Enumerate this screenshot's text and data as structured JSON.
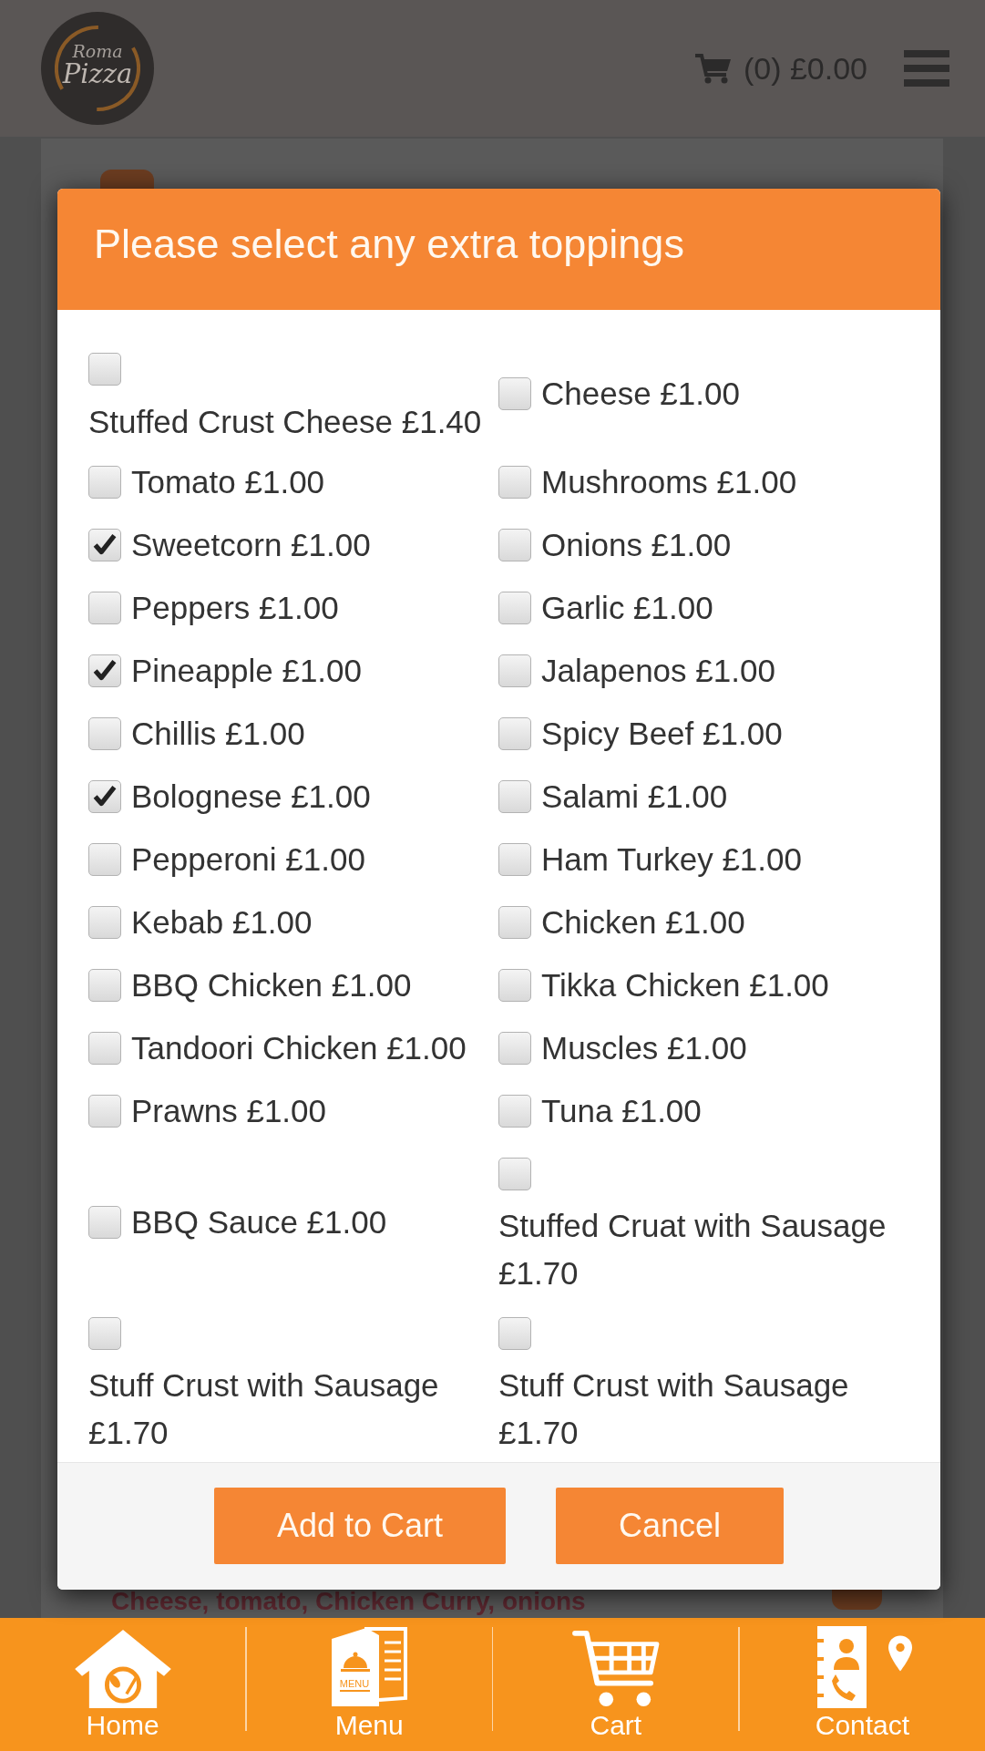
{
  "header": {
    "logo": {
      "line_1": "Roma",
      "line_2": "Pizza"
    },
    "cart_summary": "(0) £0.00"
  },
  "page": {
    "description": "Cheese, tomato, Chicken Curry, onions"
  },
  "modal": {
    "title": "Please select any extra toppings",
    "toppings": [
      {
        "label": "Stuffed Crust Cheese £1.40",
        "checked": false
      },
      {
        "label": "Tomato £1.00",
        "checked": false
      },
      {
        "label": "Sweetcorn £1.00",
        "checked": true
      },
      {
        "label": "Peppers £1.00",
        "checked": false
      },
      {
        "label": "Pineapple £1.00",
        "checked": true
      },
      {
        "label": "Chillis £1.00",
        "checked": false
      },
      {
        "label": "Bolognese £1.00",
        "checked": true
      },
      {
        "label": "Pepperoni £1.00",
        "checked": false
      },
      {
        "label": "Kebab £1.00",
        "checked": false
      },
      {
        "label": "BBQ Chicken £1.00",
        "checked": false
      },
      {
        "label": "Tandoori Chicken £1.00",
        "checked": false
      },
      {
        "label": "Prawns £1.00",
        "checked": false
      },
      {
        "label": "BBQ Sauce £1.00",
        "checked": false
      },
      {
        "label": "Stuff Crust with Sausage £1.70",
        "checked": false
      },
      {
        "label": "Cheese £1.00",
        "checked": false
      },
      {
        "label": "Mushrooms £1.00",
        "checked": false
      },
      {
        "label": "Onions £1.00",
        "checked": false
      },
      {
        "label": "Garlic £1.00",
        "checked": false
      },
      {
        "label": "Jalapenos £1.00",
        "checked": false
      },
      {
        "label": "Spicy Beef £1.00",
        "checked": false
      },
      {
        "label": "Salami £1.00",
        "checked": false
      },
      {
        "label": "Ham Turkey £1.00",
        "checked": false
      },
      {
        "label": "Chicken £1.00",
        "checked": false
      },
      {
        "label": "Tikka Chicken £1.00",
        "checked": false
      },
      {
        "label": "Muscles £1.00",
        "checked": false
      },
      {
        "label": "Tuna £1.00",
        "checked": false
      },
      {
        "label": "Stuffed Cruat with Sausage £1.70",
        "checked": false
      },
      {
        "label": "Stuff Crust with Sausage £1.70",
        "checked": false
      }
    ],
    "buttons": [
      {
        "label": "Add to Cart"
      },
      {
        "label": "Cancel"
      }
    ]
  },
  "bottom_nav": [
    {
      "kind": "home",
      "label": "Home"
    },
    {
      "kind": "menu",
      "label": "Menu",
      "icon_text": "MENU"
    },
    {
      "kind": "cart",
      "label": "Cart"
    },
    {
      "kind": "contact",
      "label": "Contact"
    }
  ]
}
